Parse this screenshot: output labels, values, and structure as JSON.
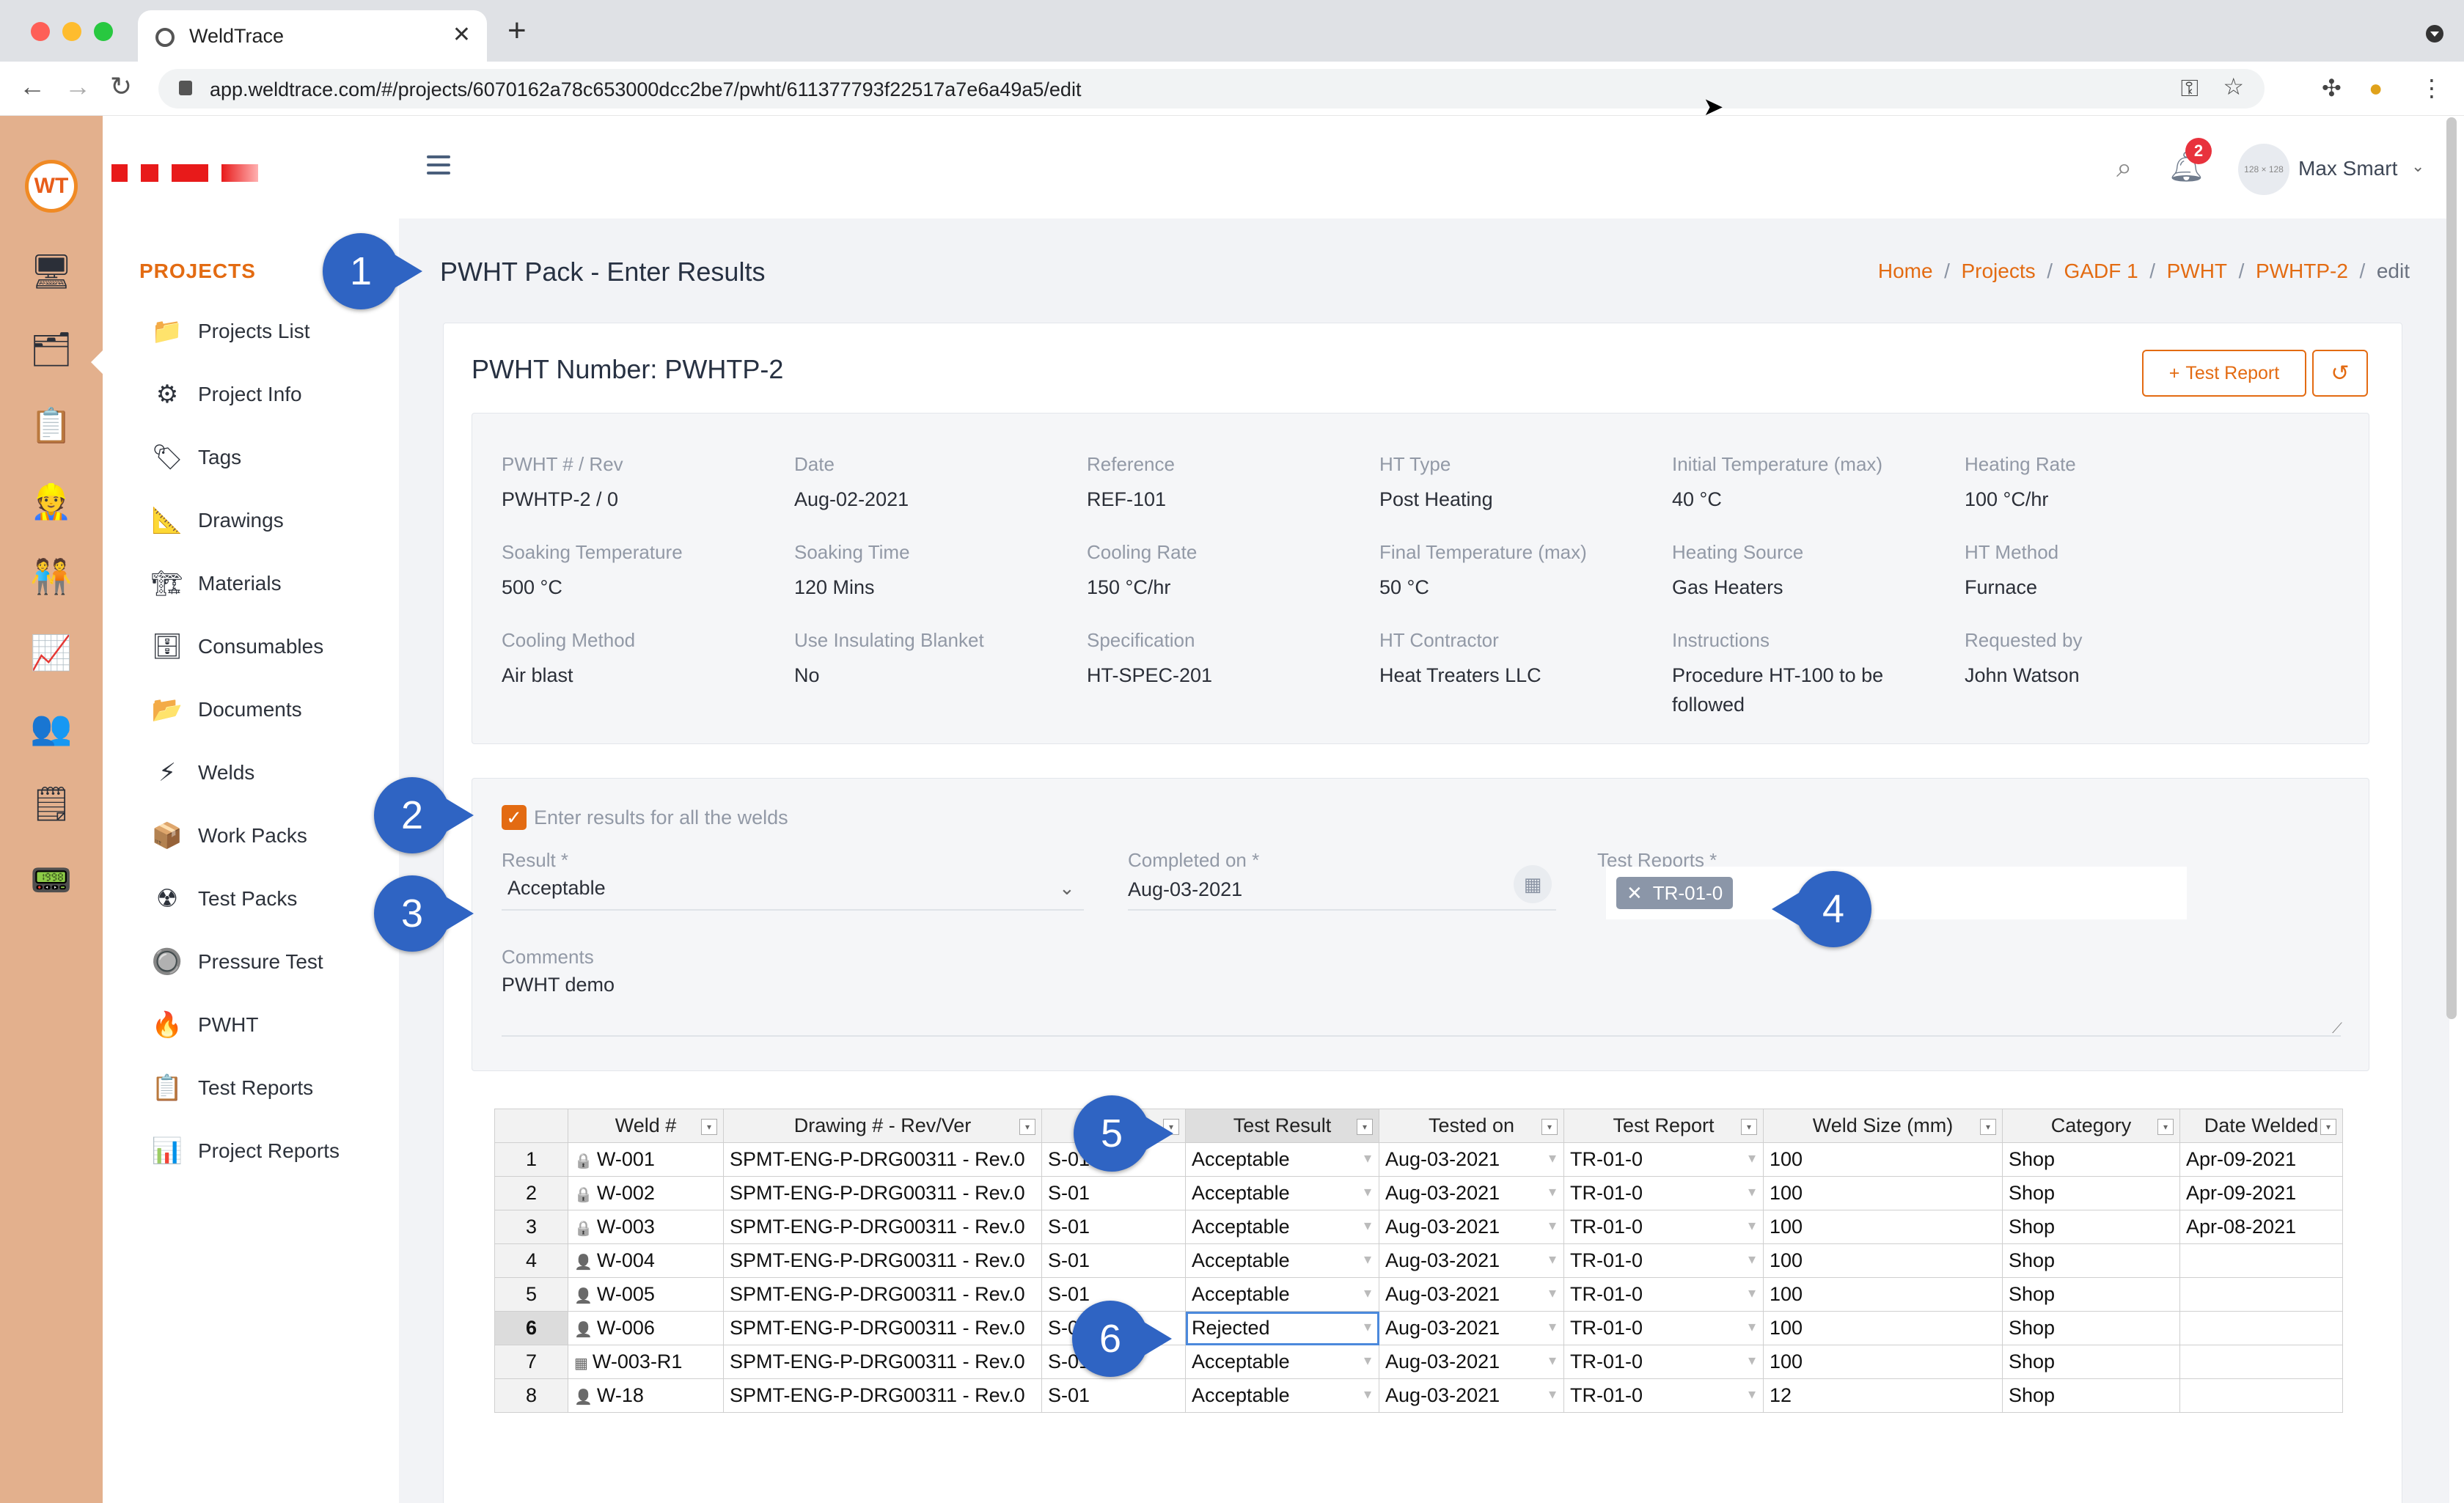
{
  "browser": {
    "tab_title": "WeldTrace",
    "url": "app.weldtrace.com/#/projects/6070162a78c653000dcc2be7/pwht/611377793f22517a7e6a49a5/edit"
  },
  "sidebar": {
    "heading": "PROJECTS",
    "items": [
      {
        "label": "Projects List",
        "icon": "📁"
      },
      {
        "label": "Project Info",
        "icon": "⚙"
      },
      {
        "label": "Tags",
        "icon": "🏷"
      },
      {
        "label": "Drawings",
        "icon": "📐"
      },
      {
        "label": "Materials",
        "icon": "🏗"
      },
      {
        "label": "Consumables",
        "icon": "🗄"
      },
      {
        "label": "Documents",
        "icon": "📂"
      },
      {
        "label": "Welds",
        "icon": "⚡"
      },
      {
        "label": "Work Packs",
        "icon": "📦"
      },
      {
        "label": "Test Packs",
        "icon": "☢"
      },
      {
        "label": "Pressure Test",
        "icon": "🔘"
      },
      {
        "label": "PWHT",
        "icon": "🔥"
      },
      {
        "label": "Test Reports",
        "icon": "📋"
      },
      {
        "label": "Project Reports",
        "icon": "📊"
      }
    ]
  },
  "header": {
    "notification_count": "2",
    "avatar_text": "128 × 128",
    "user_name": "Max Smart"
  },
  "page": {
    "title": "PWHT Pack - Enter Results",
    "breadcrumbs": [
      "Home",
      "Projects",
      "GADF 1",
      "PWHT",
      "PWHTP-2",
      "edit"
    ]
  },
  "card": {
    "title": "PWHT Number: PWHTP-2",
    "test_report_button": "Test Report"
  },
  "details": [
    {
      "label": "PWHT # / Rev",
      "value": "PWHTP-2 / 0"
    },
    {
      "label": "Date",
      "value": "Aug-02-2021"
    },
    {
      "label": "Reference",
      "value": "REF-101"
    },
    {
      "label": "HT Type",
      "value": "Post Heating"
    },
    {
      "label": "Initial Temperature (max)",
      "value": "40 °C"
    },
    {
      "label": "Heating Rate",
      "value": "100 °C/hr"
    },
    {
      "label": "Soaking Temperature",
      "value": "500 °C"
    },
    {
      "label": "Soaking Time",
      "value": "120 Mins"
    },
    {
      "label": "Cooling Rate",
      "value": "150 °C/hr"
    },
    {
      "label": "Final Temperature (max)",
      "value": "50 °C"
    },
    {
      "label": "Heating Source",
      "value": "Gas Heaters"
    },
    {
      "label": "HT Method",
      "value": "Furnace"
    },
    {
      "label": "Cooling Method",
      "value": "Air blast"
    },
    {
      "label": "Use Insulating Blanket",
      "value": "No"
    },
    {
      "label": "Specification",
      "value": "HT-SPEC-201"
    },
    {
      "label": "HT Contractor",
      "value": "Heat Treaters LLC"
    },
    {
      "label": "Instructions",
      "value": "Procedure HT-100 to be followed"
    },
    {
      "label": "Requested by",
      "value": "John Watson"
    }
  ],
  "form": {
    "checkbox_label": "Enter results for all the welds",
    "result_label": "Result *",
    "result_value": "Acceptable",
    "completed_label": "Completed on *",
    "completed_value": "Aug-03-2021",
    "reports_label": "Test Reports *",
    "report_tag": "TR-01-0",
    "comments_label": "Comments",
    "comments_value": "PWHT demo"
  },
  "grid": {
    "columns": [
      "",
      "Weld #",
      "Drawing # - Rev/Ver",
      "T",
      "Test Result",
      "Tested on",
      "Test Report",
      "Weld Size (mm)",
      "Category",
      "Date Welded"
    ],
    "rows": [
      {
        "n": "1",
        "icon": "lock",
        "weld": "W-001",
        "drawing": "SPMT-ENG-P-DRG00311 - Rev.0",
        "t": "S-01",
        "result": "Acceptable",
        "tested": "Aug-03-2021",
        "report": "TR-01-0",
        "size": "100",
        "category": "Shop",
        "welded": "Apr-09-2021"
      },
      {
        "n": "2",
        "icon": "lock",
        "weld": "W-002",
        "drawing": "SPMT-ENG-P-DRG00311 - Rev.0",
        "t": "S-01",
        "result": "Acceptable",
        "tested": "Aug-03-2021",
        "report": "TR-01-0",
        "size": "100",
        "category": "Shop",
        "welded": "Apr-09-2021"
      },
      {
        "n": "3",
        "icon": "lock",
        "weld": "W-003",
        "drawing": "SPMT-ENG-P-DRG00311 - Rev.0",
        "t": "S-01",
        "result": "Acceptable",
        "tested": "Aug-03-2021",
        "report": "TR-01-0",
        "size": "100",
        "category": "Shop",
        "welded": "Apr-08-2021"
      },
      {
        "n": "4",
        "icon": "user",
        "weld": "W-004",
        "drawing": "SPMT-ENG-P-DRG00311 - Rev.0",
        "t": "S-01",
        "result": "Acceptable",
        "tested": "Aug-03-2021",
        "report": "TR-01-0",
        "size": "100",
        "category": "Shop",
        "welded": ""
      },
      {
        "n": "5",
        "icon": "user",
        "weld": "W-005",
        "drawing": "SPMT-ENG-P-DRG00311 - Rev.0",
        "t": "S-01",
        "result": "Acceptable",
        "tested": "Aug-03-2021",
        "report": "TR-01-0",
        "size": "100",
        "category": "Shop",
        "welded": ""
      },
      {
        "n": "6",
        "icon": "user",
        "weld": "W-006",
        "drawing": "SPMT-ENG-P-DRG00311 - Rev.0",
        "t": "S-0",
        "result": "Rejected",
        "tested": "Aug-03-2021",
        "report": "TR-01-0",
        "size": "100",
        "category": "Shop",
        "welded": ""
      },
      {
        "n": "7",
        "icon": "calendar",
        "weld": "W-003-R1",
        "drawing": "SPMT-ENG-P-DRG00311 - Rev.0",
        "t": "S-01",
        "result": "Acceptable",
        "tested": "Aug-03-2021",
        "report": "TR-01-0",
        "size": "100",
        "category": "Shop",
        "welded": ""
      },
      {
        "n": "8",
        "icon": "user",
        "weld": "W-18",
        "drawing": "SPMT-ENG-P-DRG00311 - Rev.0",
        "t": "S-01",
        "result": "Acceptable",
        "tested": "Aug-03-2021",
        "report": "TR-01-0",
        "size": "12",
        "category": "Shop",
        "welded": ""
      }
    ]
  },
  "callouts": [
    "1",
    "2",
    "3",
    "4",
    "5",
    "6"
  ]
}
